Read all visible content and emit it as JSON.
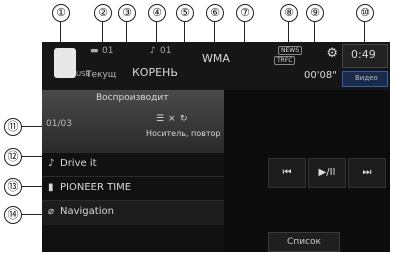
{
  "callouts": [
    "①",
    "②",
    "③",
    "④",
    "⑤",
    "⑥",
    "⑦",
    "⑧",
    "⑨",
    "⑩",
    "⑪",
    "⑫",
    "⑬",
    "⑭"
  ],
  "source": {
    "label": "USB",
    "icon": "usb-stick-icon"
  },
  "folder": {
    "icon": "folder-icon",
    "value": "01"
  },
  "track": {
    "icon": "music-note-icon",
    "value": "01"
  },
  "mode_label": "Текущ",
  "root_label": "КОРЕНЬ",
  "format": "WMA",
  "traffic": {
    "news": "NEWS",
    "trfc": "TRFC"
  },
  "clock": "0:49",
  "elapsed": "00'08\"",
  "settings_icon": "gear-icon",
  "video_button": "Видео",
  "playing_header": "Воспроизводит",
  "track_position": "01/03",
  "status_icons": [
    "list-icon",
    "random-icon",
    "repeat-icon"
  ],
  "status_text": "Носитель, повтор",
  "list_rows": [
    {
      "icon": "music-note-icon",
      "text": "Drive it"
    },
    {
      "icon": "artist-icon",
      "text": "PIONEER TIME"
    },
    {
      "icon": "album-icon",
      "text": "Navigation"
    }
  ],
  "controls": {
    "prev": "⏮",
    "play_pause": "▶/II",
    "next": "⏭"
  },
  "list_button": "Список"
}
